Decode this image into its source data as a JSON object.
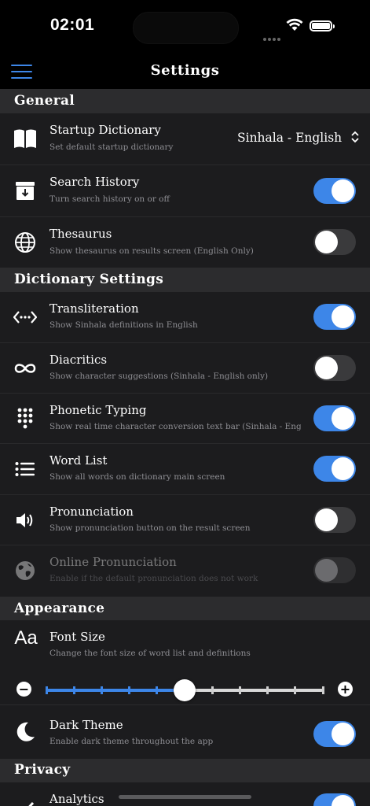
{
  "status_bar": {
    "time": "02:01"
  },
  "nav": {
    "title": "Settings"
  },
  "sections": {
    "general": "General",
    "dictionary": "Dictionary Settings",
    "appearance": "Appearance",
    "privacy": "Privacy"
  },
  "general": {
    "startup": {
      "title": "Startup Dictionary",
      "sub": "Set default startup dictionary",
      "value": "Sinhala - English",
      "icon": "book-icon"
    },
    "history": {
      "title": "Search History",
      "sub": "Turn search history on or off",
      "on": true,
      "icon": "archive-icon"
    },
    "thesaurus": {
      "title": "Thesaurus",
      "sub": "Show thesaurus on results screen (English Only)",
      "on": false,
      "icon": "globe-icon"
    }
  },
  "dictionary": {
    "transliteration": {
      "title": "Transliteration",
      "sub": "Show Sinhala definitions in English",
      "on": true,
      "icon": "code-arrows-icon"
    },
    "diacritics": {
      "title": "Diacritics",
      "sub": "Show character suggestions (Sinhala - English only)",
      "on": false,
      "icon": "infinity-icon"
    },
    "phonetic": {
      "title": "Phonetic Typing",
      "sub": "Show real time character conversion text bar (Sinhala - English on",
      "on": true,
      "icon": "keypad-icon"
    },
    "wordlist": {
      "title": "Word List",
      "sub": "Show all words on dictionary main screen",
      "on": true,
      "icon": "list-icon"
    },
    "pronunciation": {
      "title": "Pronunciation",
      "sub": "Show pronunciation button on the result screen",
      "on": false,
      "icon": "speaker-icon"
    },
    "online": {
      "title": "Online Pronunciation",
      "sub": "Enable if the default pronunciation does not work",
      "on": false,
      "disabled": true,
      "icon": "earth-icon"
    }
  },
  "appearance": {
    "fontsize": {
      "title": "Font Size",
      "sub": "Change the font size of word list and definitions",
      "icon_text": "Aa",
      "level": 5,
      "steps": 10
    },
    "dark": {
      "title": "Dark Theme",
      "sub": "Enable dark theme throughout the app",
      "on": true,
      "icon": "moon-icon"
    }
  },
  "privacy": {
    "analytics": {
      "title": "Analytics",
      "on": true
    }
  },
  "colors": {
    "accent": "#3d86e8",
    "bg": "#1c1c1e",
    "section": "#2c2c2e"
  }
}
